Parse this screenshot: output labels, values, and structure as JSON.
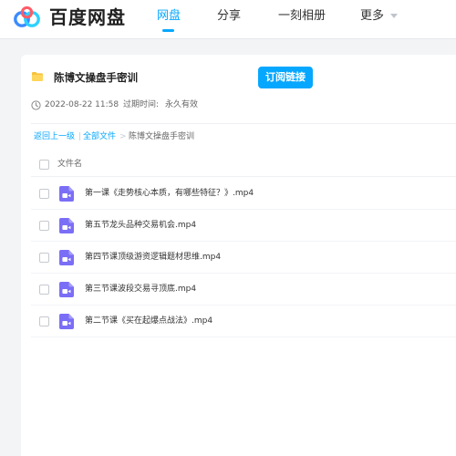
{
  "header": {
    "brand": "百度网盘",
    "nav": [
      {
        "label": "网盘",
        "active": true
      },
      {
        "label": "分享",
        "active": false
      },
      {
        "label": "一刻相册",
        "active": false
      },
      {
        "label": "更多",
        "active": false
      }
    ],
    "accent_color": "#06a7ff",
    "logo_icon": "baidu-netdisk-cloud-logo"
  },
  "share": {
    "folder_icon": "folder-icon",
    "title": "陈博文操盘手密训",
    "subscribe_label": "订阅链接",
    "date": "2022-08-22 11:58",
    "expire_label": "过期时间:",
    "expire_value": "永久有效"
  },
  "breadcrumb": {
    "back": "返回上一级",
    "separator_1": "|",
    "all_files": "全部文件",
    "separator_2": ">",
    "current": "陈博文操盘手密训"
  },
  "list": {
    "column_header": "文件名",
    "file_icon": "video-file-icon",
    "files": [
      {
        "name": "第一课《走势核心本质，有哪些特征？》.mp4"
      },
      {
        "name": "第五节龙头品种交易机会.mp4"
      },
      {
        "name": "第四节课顶级游资逻辑题材思维.mp4"
      },
      {
        "name": "第三节课波段交易寻顶底.mp4"
      },
      {
        "name": "第二节课《买在起爆点战法》.mp4"
      }
    ]
  }
}
